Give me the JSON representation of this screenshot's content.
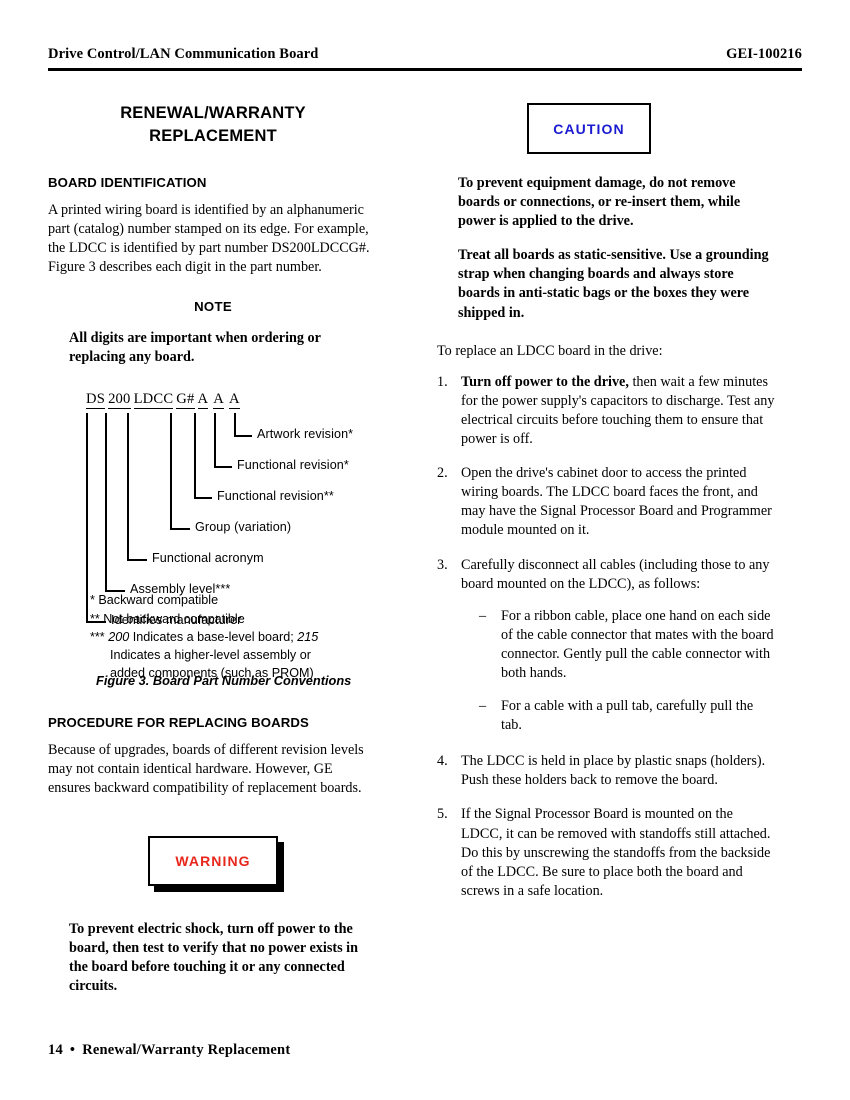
{
  "header": {
    "left": "Drive Control/LAN Communication Board",
    "right": "GEI-100216"
  },
  "footer": {
    "page_number": "14",
    "bullet": "•",
    "title": "Renewal/Warranty Replacement"
  },
  "left_column": {
    "chapter_title_line1": "RENEWAL/WARRANTY",
    "chapter_title_line2": "REPLACEMENT",
    "board_identification": {
      "heading": "BOARD IDENTIFICATION",
      "paragraph": "A printed wiring board is identified by an alphanumeric part (catalog) number stamped on its edge. For example, the LDCC is identified by part number DS200LDCCG#. Figure 3 describes each digit in the part number."
    },
    "note": {
      "title": "NOTE",
      "body": "All digits are important when ordering or replacing any board."
    },
    "figure": {
      "part_number_segments": [
        "DS",
        "200",
        "LDCC",
        "G#",
        "A",
        "A",
        "A"
      ],
      "callouts": [
        "Artwork revision*",
        "Functional revision*",
        "Functional revision**",
        "Group (variation)",
        "Functional acronym",
        "Assembly level***",
        "Identifies manufacturer"
      ],
      "footnotes": {
        "one_star": "*  Backward compatible",
        "two_star": "**  Not backward compatible",
        "three_star_prefix": "***",
        "three_star_a": "200",
        "three_star_b": "Indicates a base-level board;",
        "three_star_c": "215",
        "three_star_line2": "Indicates a higher-level assembly or",
        "three_star_line3": "added components (such as PROM)"
      },
      "caption": "Figure 3.  Board Part Number Conventions"
    },
    "procedure": {
      "heading": "PROCEDURE FOR REPLACING BOARDS",
      "paragraph": "Because of upgrades, boards of different revision levels may not contain identical hardware. However, GE ensures backward compatibility of replacement boards."
    },
    "warning": {
      "label": "WARNING",
      "color": "#e8271c",
      "body": "To prevent electric shock, turn off power to the board, then test to verify that no power exists in the board before touching it or any connected circuits."
    }
  },
  "right_column": {
    "caution": {
      "label": "CAUTION",
      "color": "#1a1ad0",
      "body_1": "To prevent equipment damage, do not remove boards or connections, or re-insert them, while power is applied to the drive.",
      "body_2": "Treat all boards as static-sensitive. Use a grounding strap when changing boards and always store boards in anti-static bags or the boxes they were shipped in."
    },
    "intro": "To replace an LDCC board in the drive:",
    "steps": [
      {
        "num": "1.",
        "bold_lead": "Turn off power to the drive,",
        "text": " then wait a few minutes for the power supply's capacitors to discharge. Test any electrical circuits before touching them to ensure that power is off."
      },
      {
        "num": "2.",
        "bold_lead": "",
        "text": "Open the drive's cabinet door to access the printed wiring boards. The LDCC board faces the front, and may have the Signal Processor Board and Programmer module mounted on it."
      },
      {
        "num": "3.",
        "bold_lead": "",
        "text": "Carefully disconnect all cables (including those to any board mounted on the LDCC), as follows:"
      },
      {
        "num": "4.",
        "bold_lead": "",
        "text": "The LDCC is held in place by plastic snaps (holders). Push these holders back to remove the board."
      },
      {
        "num": "5.",
        "bold_lead": "",
        "text": "If the Signal Processor Board is mounted on the LDCC, it can be removed with standoffs still attached. Do this by unscrewing the standoffs from the backside of the LDCC. Be sure to place both the board and screws in a safe location."
      }
    ],
    "substeps": [
      {
        "dash": "–",
        "text": "For a ribbon cable, place one hand on each side of the cable connector that mates with the board connector. Gently pull the cable connector with both hands."
      },
      {
        "dash": "–",
        "text": "For a cable with a pull tab, carefully pull the tab."
      }
    ]
  }
}
